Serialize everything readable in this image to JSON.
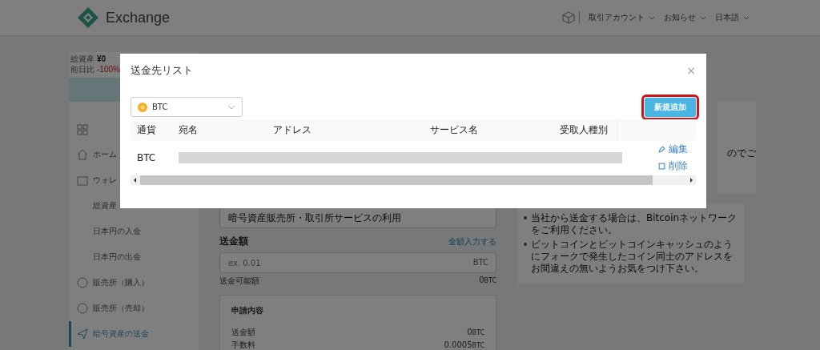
{
  "header": {
    "logo": "Exchange",
    "menus": [
      {
        "label": "取引アカウント"
      },
      {
        "label": "お知らせ"
      },
      {
        "label": "日本語"
      }
    ]
  },
  "sidebar": {
    "summary": [
      {
        "label": "総資産",
        "value": "¥0"
      },
      {
        "label": "前日比",
        "value": "-100%"
      }
    ],
    "items": [
      {
        "label": "ホーム",
        "kind": "home",
        "selected": false
      },
      {
        "label": "ウォレ",
        "kind": "wallet",
        "selected": false
      },
      {
        "label": "総資産",
        "kind": "sub",
        "selected": false
      },
      {
        "label": "日本円の入金",
        "kind": "sub",
        "selected": false
      },
      {
        "label": "日本円の出金",
        "kind": "sub",
        "selected": false
      },
      {
        "label": "販売所（購入）",
        "kind": "coin",
        "selected": false
      },
      {
        "label": "販売所（売却）",
        "kind": "coin",
        "selected": false
      },
      {
        "label": "暗号資産の送金",
        "kind": "send",
        "selected": true
      }
    ]
  },
  "form": {
    "purpose": "暗号資産販売所・取引所サービスの利用",
    "amount_label": "送金額",
    "all_link": "全額入力する",
    "amount_placeholder": "ex. 0.01",
    "amount_unit": "BTC",
    "available_label": "送金可能額",
    "available_value": "0",
    "available_unit": "BTC",
    "summary": {
      "title": "申請内容",
      "rows": [
        {
          "label": "送金額",
          "value": "0",
          "unit": "BTC"
        },
        {
          "label": "手数料",
          "value": "0.0005",
          "unit": "BTC"
        }
      ]
    }
  },
  "notice": {
    "fragment": "のでご",
    "bullets": [
      "当社から送金する場合は、Bitcoinネットワークをご利用ください。",
      "ビットコインとビットコインキャッシュのようにフォークで発生したコイン同士のアドレスをお間違えの無いようお気をつけ下さい。"
    ]
  },
  "dialog": {
    "title": "送金先リスト",
    "close": "×",
    "currency": "BTC",
    "add_button": {
      "label": "新規追加",
      "highlighted": true
    },
    "table": {
      "columns": [
        "通貨",
        "宛名",
        "アドレス",
        "サービス名",
        "受取人種別"
      ],
      "rows": [
        {
          "currency": "BTC",
          "redacted": true,
          "actions": [
            {
              "label": "編集",
              "kind": "edit"
            },
            {
              "label": "削除",
              "kind": "delete"
            }
          ]
        }
      ]
    }
  }
}
